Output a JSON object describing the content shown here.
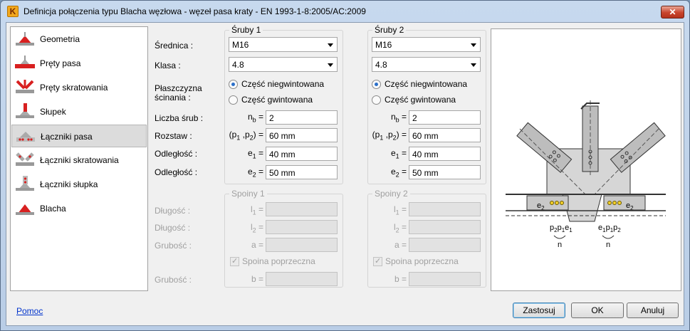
{
  "window": {
    "title": "Definicja połączenia typu Blacha węzłowa - węzeł pasa kraty - EN 1993-1-8:2005/AC:2009",
    "app_icon": "K",
    "close_glyph": "✕"
  },
  "nav": {
    "items": [
      {
        "label": "Geometria",
        "icon": "geometry-icon"
      },
      {
        "label": "Pręty pasa",
        "icon": "chord-members-icon"
      },
      {
        "label": "Pręty skratowania",
        "icon": "bracing-members-icon"
      },
      {
        "label": "Słupek",
        "icon": "post-icon"
      },
      {
        "label": "Łączniki pasa",
        "icon": "chord-fasteners-icon",
        "selected": true
      },
      {
        "label": "Łączniki skratowania",
        "icon": "bracing-fasteners-icon"
      },
      {
        "label": "Łączniki słupka",
        "icon": "post-fasteners-icon"
      },
      {
        "label": "Blacha",
        "icon": "plate-icon"
      }
    ]
  },
  "labels": {
    "srednica": "Średnica :",
    "klasa": "Klasa :",
    "plaszczyzna1": "Płaszczyzna",
    "plaszczyzna2": "ścinania :",
    "liczba": "Liczba śrub :",
    "rozstaw": "Rozstaw :",
    "odleglosc1": "Odległość :",
    "odleglosc2": "Odległość :",
    "dlugosc1": "Długość :",
    "dlugosc2": "Długość :",
    "grubosc1": "Grubość :",
    "grubosc2": "Grubość :"
  },
  "bolts": [
    {
      "title": "Śruby 1",
      "diameter": "M16",
      "class": "4.8",
      "radio_unthreaded": "Część niegwintowana",
      "radio_threaded": "Część gwintowana",
      "selected": "unthreaded",
      "nb": "2",
      "spacing": "60 mm",
      "e1": "40 mm",
      "e2": "50 mm"
    },
    {
      "title": "Śruby 2",
      "diameter": "M16",
      "class": "4.8",
      "radio_unthreaded": "Część niegwintowana",
      "radio_threaded": "Część gwintowana",
      "selected": "unthreaded",
      "nb": "2",
      "spacing": "60 mm",
      "e1": "40 mm",
      "e2": "50 mm"
    }
  ],
  "bolt_prefixes": {
    "nb_main": "n",
    "nb_sub": "b",
    "eq": " =",
    "p_open": "(p",
    "p1_sub": "1",
    "p_mid": " ,p",
    "p2_sub": "2",
    "p_close": ") =",
    "e": "e",
    "e1_sub": "1",
    "e2_sub": "2"
  },
  "welds": [
    {
      "title": "Spoiny 1",
      "l1": "",
      "l2": "",
      "a": "",
      "b": "",
      "transverse": "Spoina poprzeczna"
    },
    {
      "title": "Spoiny 2",
      "l1": "",
      "l2": "",
      "a": "",
      "b": "",
      "transverse": "Spoina poprzeczna"
    }
  ],
  "weld_prefixes": {
    "l": "l",
    "l1_sub": "1",
    "l2_sub": "2",
    "a": "a =",
    "b": "b =",
    "eq": " ="
  },
  "preview_labels": {
    "e2": "e",
    "e2_sub": "2",
    "p2": "p",
    "p1": "p",
    "e1": "e",
    "s1": "1",
    "s2": "2",
    "n": "n"
  },
  "footer": {
    "help": "Pomoc",
    "apply": "Zastosuj",
    "ok": "OK",
    "cancel": "Anuluj"
  }
}
